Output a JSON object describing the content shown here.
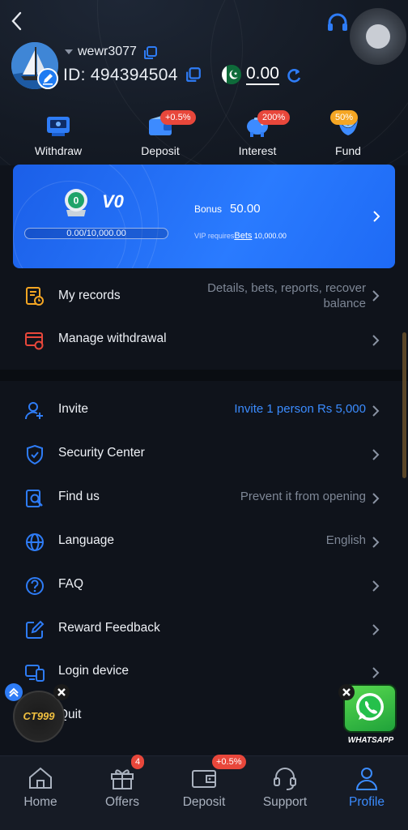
{
  "header": {
    "back_icon": "chevron-left-icon",
    "support_icon": "headset-icon"
  },
  "profile": {
    "username": "wewr3077",
    "id_label": "ID: 494394504",
    "balance": "0.00",
    "flag": "pakistan-flag-icon"
  },
  "quick_actions": [
    {
      "label": "Withdraw",
      "icon": "atm-icon",
      "badge": ""
    },
    {
      "label": "Deposit",
      "icon": "wallet-icon",
      "badge": "+0.5%"
    },
    {
      "label": "Interest",
      "icon": "piggy-bank-icon",
      "badge": "200%"
    },
    {
      "label": "Fund",
      "icon": "fund-icon",
      "badge": "50%"
    }
  ],
  "vip": {
    "level": "V0",
    "medal_number": "0",
    "progress_text": "0.00/10,000.00",
    "progress_fraction": 0,
    "bonus_label": "Bonus",
    "bonus_value": "50.00",
    "requires_label": "VIP requires",
    "requires_bets": "Bets",
    "requires_value": "10,000.00"
  },
  "menu_top": [
    {
      "label": "My records",
      "icon": "records-icon",
      "value": "Details, bets, reports, recover balance"
    },
    {
      "label": "Manage withdrawal",
      "icon": "card-gear-icon",
      "value": ""
    }
  ],
  "menu_main": [
    {
      "label": "Invite",
      "icon": "invite-user-icon",
      "value": "Invite 1 person Rs 5,000"
    },
    {
      "label": "Security Center",
      "icon": "shield-icon",
      "value": ""
    },
    {
      "label": "Find us",
      "icon": "find-icon",
      "value": "Prevent it from opening"
    },
    {
      "label": "Language",
      "icon": "globe-icon",
      "value": "English"
    },
    {
      "label": "FAQ",
      "icon": "question-icon",
      "value": ""
    },
    {
      "label": "Reward Feedback",
      "icon": "edit-icon",
      "value": ""
    },
    {
      "label": "Login device",
      "icon": "device-icon",
      "value": ""
    },
    {
      "label": "Quit",
      "icon": "",
      "value": ""
    }
  ],
  "floating": {
    "ct_logo": "CT999",
    "whatsapp_label": "WHATSAPP"
  },
  "tabbar": [
    {
      "label": "Home",
      "icon": "home-icon",
      "badge": ""
    },
    {
      "label": "Offers",
      "icon": "gift-icon",
      "badge": "4"
    },
    {
      "label": "Deposit",
      "icon": "wallet-icon",
      "badge": "+0.5%"
    },
    {
      "label": "Support",
      "icon": "headset-icon",
      "badge": ""
    },
    {
      "label": "Profile",
      "icon": "user-icon",
      "badge": ""
    }
  ],
  "colors": {
    "accent": "#3b8cff",
    "vip_card": "#2272f7",
    "badge_red": "#e8473b",
    "badge_gold": "#f5a623",
    "background": "#0f131b"
  }
}
